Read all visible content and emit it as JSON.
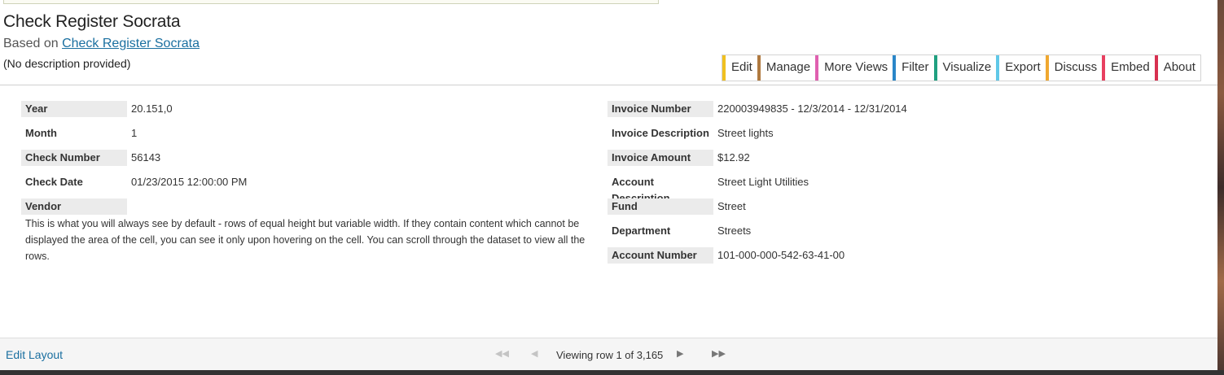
{
  "header": {
    "title": "Check Register Socrata",
    "based_on_prefix": "Based on",
    "based_on_link": "Check Register Socrata",
    "description": "(No description provided)"
  },
  "toolbar": {
    "buttons": [
      {
        "label": "Edit",
        "color": "#f0c020"
      },
      {
        "label": "Manage",
        "color": "#b07a40"
      },
      {
        "label": "More Views",
        "color": "#e060b0"
      },
      {
        "label": "Filter",
        "color": "#2a86c8"
      },
      {
        "label": "Visualize",
        "color": "#20a080"
      },
      {
        "label": "Export",
        "color": "#60c8e8"
      },
      {
        "label": "Discuss",
        "color": "#f0a830"
      },
      {
        "label": "Embed",
        "color": "#e84060"
      },
      {
        "label": "About",
        "color": "#d83050"
      }
    ]
  },
  "record": {
    "left": [
      {
        "label": "Year",
        "value": "20.151,0",
        "shaded": true
      },
      {
        "label": "Month",
        "value": "1",
        "shaded": false
      },
      {
        "label": "Check Number",
        "value": "56143",
        "shaded": true
      },
      {
        "label": "Check Date",
        "value": "01/23/2015 12:00:00 PM",
        "shaded": false
      },
      {
        "label": "Vendor",
        "value": "",
        "shaded": true
      }
    ],
    "vendor_text": "This is what you will always see by default - rows of equal height but variable width. If they contain content which cannot be displayed the area of the cell, you can see it only upon hovering on the cell. You can scroll through the dataset to view all the rows.",
    "right": [
      {
        "label": "Invoice Number",
        "value": "220003949835 - 12/3/2014 - 12/31/2014",
        "shaded": true
      },
      {
        "label": "Invoice Description",
        "value": "Street lights",
        "shaded": false
      },
      {
        "label": "Invoice Amount",
        "value": "$12.92",
        "shaded": true
      },
      {
        "label": "Account Description",
        "value": "Street Light Utilities",
        "shaded": false
      },
      {
        "label": "Fund",
        "value": "Street",
        "shaded": true
      },
      {
        "label": "Department",
        "value": "Streets",
        "shaded": false
      },
      {
        "label": "Account Number",
        "value": "101-000-000-542-63-41-00",
        "shaded": true
      }
    ]
  },
  "footer": {
    "edit_layout": "Edit Layout",
    "pager_text": "Viewing row 1 of 3,165",
    "icons": [
      "first-page-icon",
      "prev-page-icon",
      "next-page-icon",
      "last-page-icon"
    ]
  }
}
